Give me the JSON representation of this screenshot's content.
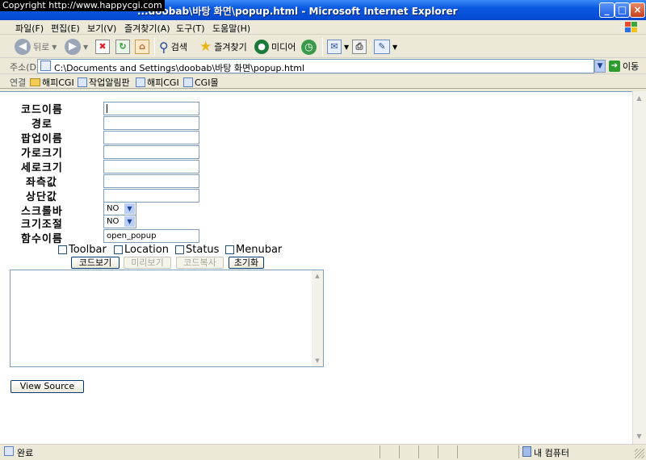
{
  "window": {
    "copyright": "Copyright  http://www.happycgi.com",
    "title": "...doobab\\바탕 화면\\popup.html - Microsoft Internet Explorer",
    "minimize": "_",
    "maximize": "□",
    "close": "×"
  },
  "menu": [
    "파일(F)",
    "편집(E)",
    "보기(V)",
    "즐겨찾기(A)",
    "도구(T)",
    "도움말(H)"
  ],
  "toolbar": {
    "back": "뒤로",
    "search": "검색",
    "favorites": "즐겨찾기",
    "media": "미디어"
  },
  "address": {
    "label": "주소(D)",
    "url": "C:\\Documents and Settings\\doobab\\바탕 화면\\popup.html",
    "go": "이동"
  },
  "links": {
    "label": "연결",
    "items": [
      "해피CGI",
      "작업알림판",
      "해피CGI",
      "CGI몰"
    ]
  },
  "form": {
    "labels": [
      "코드이름",
      "경로",
      "팝업이름",
      "가로크기",
      "세로크기",
      "좌측값",
      "상단값",
      "스크롤바",
      "크기조절",
      "함수이름"
    ],
    "code_name": "",
    "path": "",
    "popup_name": "",
    "width": "",
    "height": "",
    "left": "",
    "top": "",
    "scrollbar": "NO",
    "resizable": "NO",
    "function_name": "open_popup",
    "checkboxes": [
      "Toolbar",
      "Location",
      "Status",
      "Menubar"
    ],
    "buttons": {
      "view_code": "코드보기",
      "preview": "미리보기",
      "copy_code": "코드복사",
      "reset": "초기화"
    },
    "code_output": "",
    "view_source": "View Source"
  },
  "status": {
    "text": "완료",
    "zone": "내 컴퓨터"
  }
}
